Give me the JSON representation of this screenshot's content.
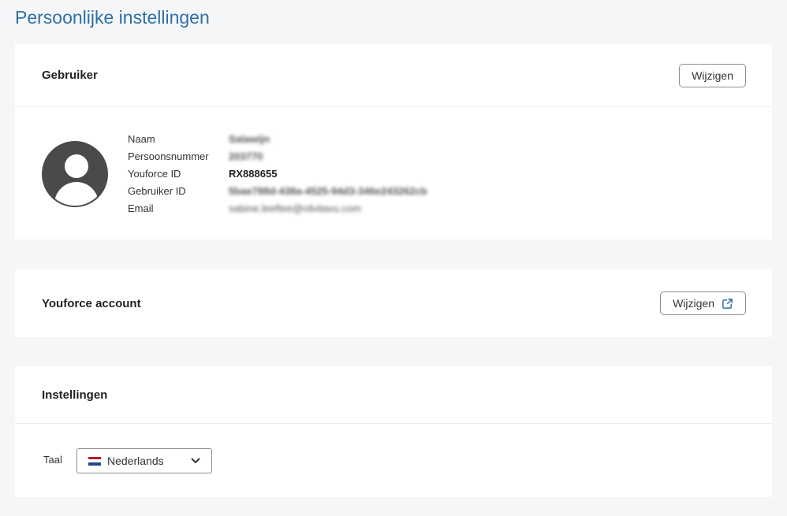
{
  "page": {
    "title": "Persoonlijke instellingen"
  },
  "user_card": {
    "title": "Gebruiker",
    "edit_label": "Wijzigen",
    "fields": [
      {
        "label": "Naam",
        "value": "Salawijn"
      },
      {
        "label": "Persoonsnummer",
        "value": "203770"
      },
      {
        "label": "Youforce ID",
        "value": "RX888655"
      },
      {
        "label": "Gebruiker ID",
        "value": "5bae788d-438a-4525-94d3-346e243262cb"
      },
      {
        "label": "Email",
        "value": "sabine.leeftee@rdvitavu.com"
      }
    ]
  },
  "account_card": {
    "title": "Youforce account",
    "edit_label": "Wijzigen",
    "edit_icon": "external-link-icon"
  },
  "settings_card": {
    "title": "Instellingen",
    "language_label": "Taal",
    "language_selected": "Nederlands",
    "language_flag": "netherlands-flag-icon"
  },
  "colors": {
    "title_blue": "#2f6fa7",
    "background": "#f5f6f8",
    "card": "#ffffff",
    "flag_red": "#ae1c28",
    "flag_white": "#ffffff",
    "flag_blue": "#21468b",
    "link_icon": "#2f6fa7"
  }
}
